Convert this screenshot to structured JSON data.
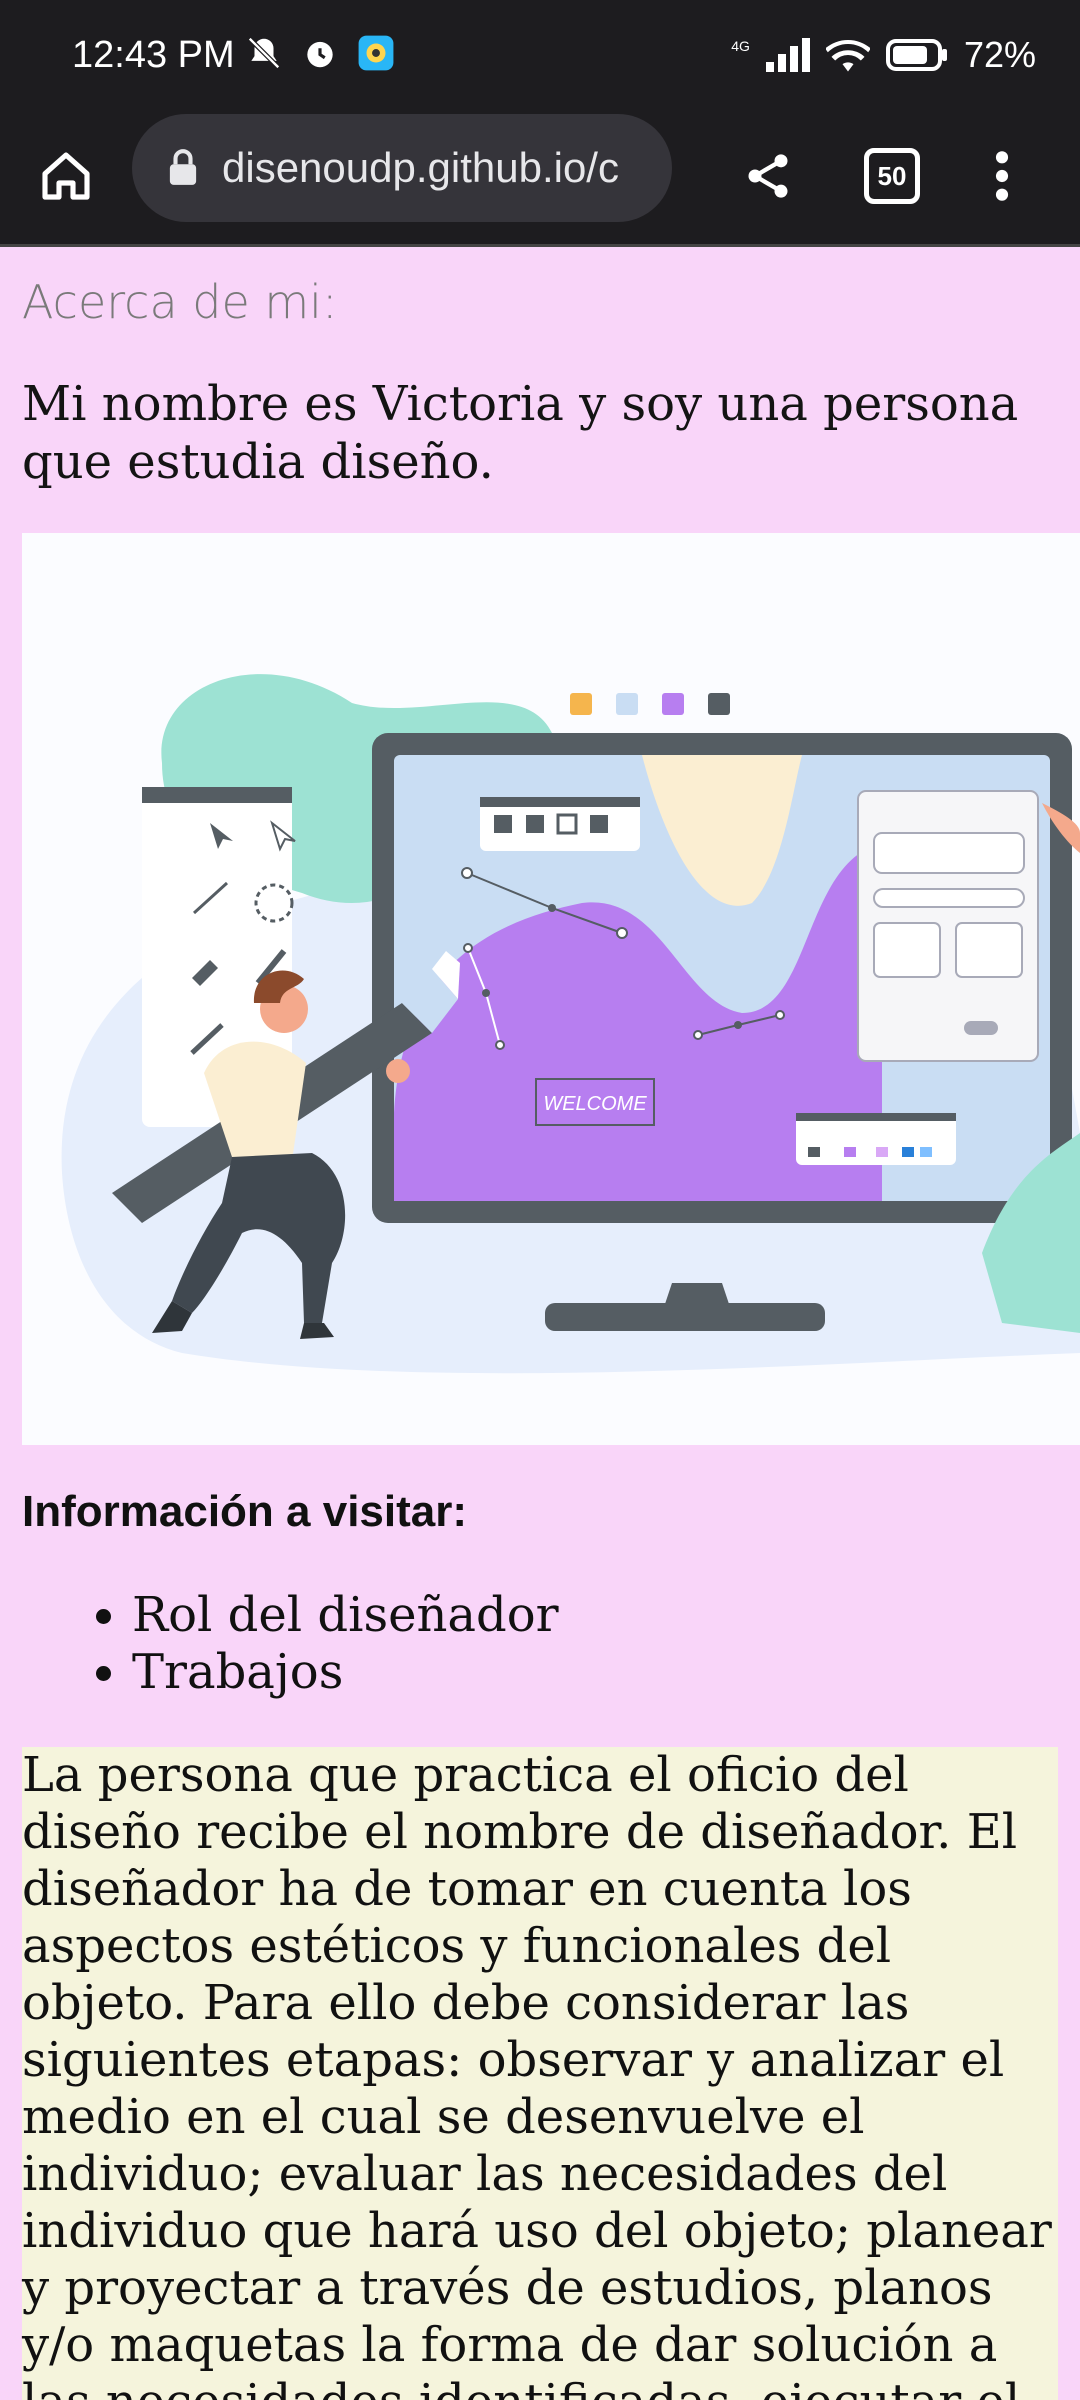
{
  "status": {
    "time": "12:43 PM",
    "network": "4G",
    "battery": "72%"
  },
  "browser": {
    "url": "disenoudp.github.io/c",
    "tab_count": "50"
  },
  "page": {
    "section_label": "Acerca de mi:",
    "intro": "Mi nombre es Victoria y soy una persona que estudia diseño.",
    "illustration": {
      "welcome_text": "WELCOME"
    },
    "info_heading": "Información a visitar:",
    "links": [
      "Rol del diseñador",
      "Trabajos"
    ],
    "description": "La persona que practica el oficio del diseño recibe el nombre de diseñador. El diseñador ha de tomar en cuenta los aspectos estéticos y funcionales del objeto. Para ello debe considerar las siguientes etapas: observar y analizar el medio en el cual se desenvuelve el individuo; evaluar las necesidades del individuo que hará uso del objeto; planear y proyectar a través de estudios, planos y/o maquetas la forma de dar solución a las necesidades identificadas, ejecutar el proyecto."
  },
  "colors": {
    "page_bg": "#f9d5f9",
    "chrome_bg": "#1d1c1f",
    "desc_bg": "#f5f4dc",
    "accent_purple": "#b77ef0"
  }
}
